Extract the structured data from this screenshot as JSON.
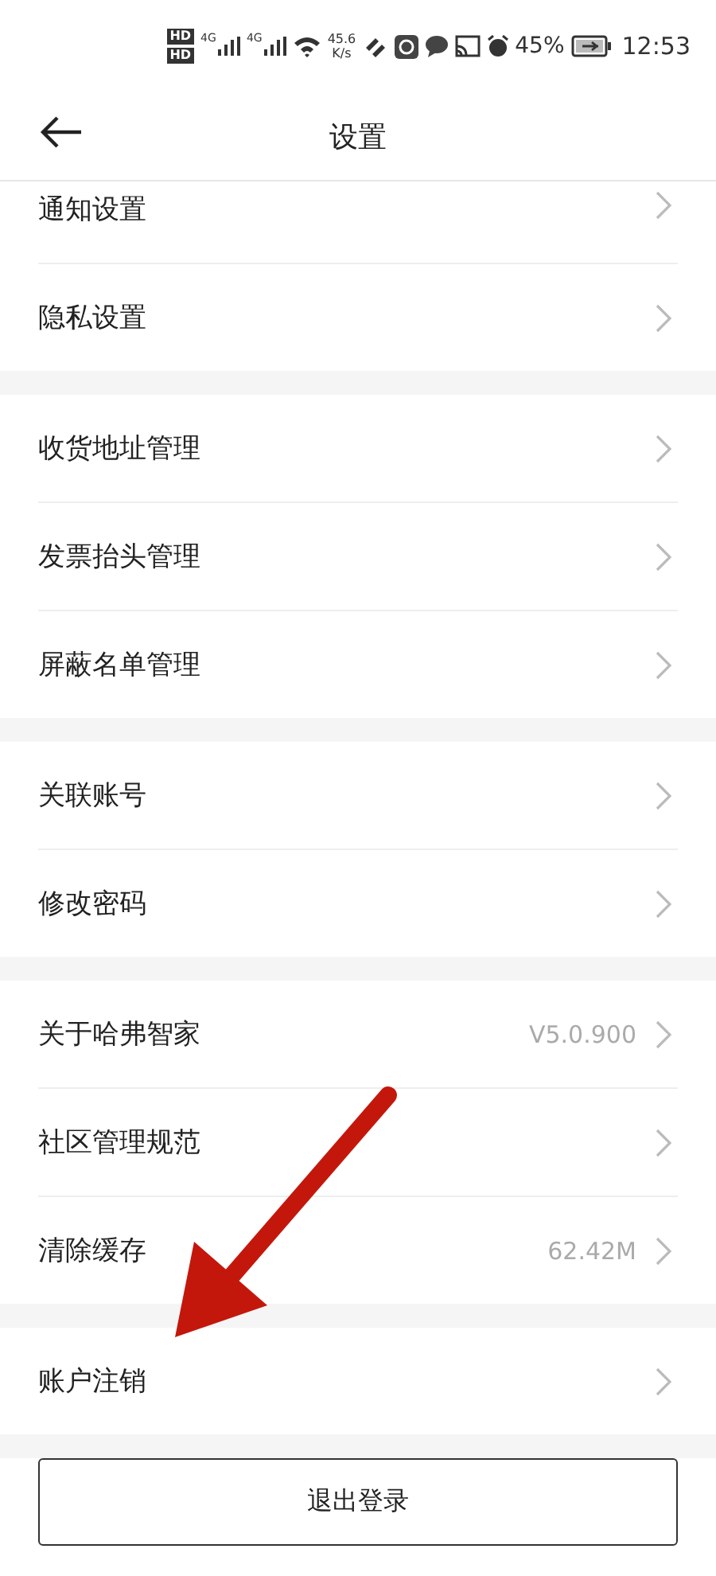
{
  "status_bar": {
    "sim_labels": [
      "HD",
      "HD"
    ],
    "network_labels": [
      "4G",
      "4G"
    ],
    "speed": [
      "45.6",
      "K/s"
    ],
    "battery": "45%",
    "time": "12:53"
  },
  "header": {
    "title": "设置"
  },
  "groups": [
    {
      "items": [
        {
          "label": "通知设置"
        },
        {
          "label": "隐私设置"
        }
      ]
    },
    {
      "items": [
        {
          "label": "收货地址管理"
        },
        {
          "label": "发票抬头管理"
        },
        {
          "label": "屏蔽名单管理"
        }
      ]
    },
    {
      "items": [
        {
          "label": "关联账号"
        },
        {
          "label": "修改密码"
        }
      ]
    },
    {
      "items": [
        {
          "label": "关于哈弗智家",
          "value": "V5.0.900"
        },
        {
          "label": "社区管理规范"
        },
        {
          "label": "清除缓存",
          "value": "62.42M"
        }
      ]
    },
    {
      "items": [
        {
          "label": "账户注销"
        }
      ]
    }
  ],
  "logout_button": "退出登录"
}
